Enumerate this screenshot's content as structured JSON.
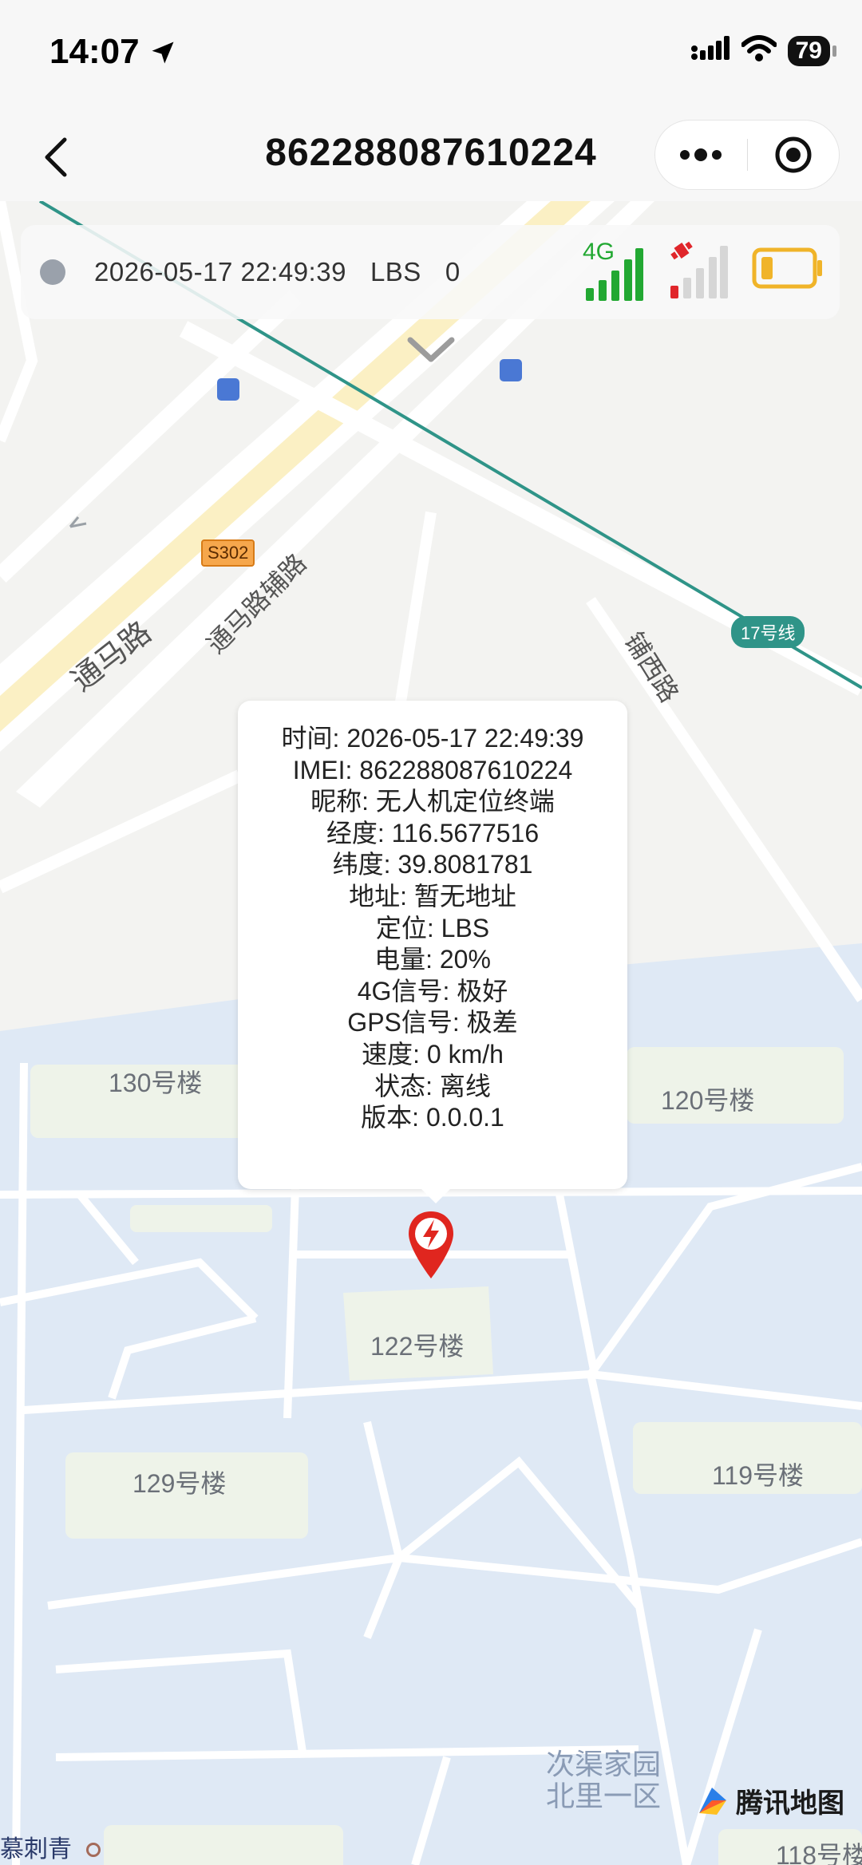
{
  "status_bar": {
    "time": "14:07",
    "battery": "79"
  },
  "nav": {
    "title": "862288087610224"
  },
  "info_bar": {
    "datetime": "2026-05-17 22:49:39",
    "mode": "LBS",
    "count": "0",
    "network_label": "4G"
  },
  "popup": {
    "lines": [
      {
        "label": "时间: ",
        "value": "2026-05-17 22:49:39"
      },
      {
        "label": "IMEI: ",
        "value": "862288087610224"
      },
      {
        "label": "昵称: ",
        "value": "无人机定位终端"
      },
      {
        "label": "经度: ",
        "value": "116.5677516"
      },
      {
        "label": "纬度: ",
        "value": "39.8081781"
      },
      {
        "label": "地址: ",
        "value": "暂无地址"
      },
      {
        "label": "定位: ",
        "value": "LBS"
      },
      {
        "label": "电量: ",
        "value": "20%"
      },
      {
        "label": "4G信号: ",
        "value": "极好"
      },
      {
        "label": "GPS信号: ",
        "value": "极差"
      },
      {
        "label": "速度: ",
        "value": "0 km/h"
      },
      {
        "label": "状态: ",
        "value": "离线"
      },
      {
        "label": "版本: ",
        "value": " 0.0.0.1"
      }
    ]
  },
  "map": {
    "roads": {
      "tongma": "通马路",
      "tongma_aux": "通马路辅路",
      "puxi": "铺西路",
      "s302": "S302",
      "metro": "17号线"
    },
    "buildings": {
      "b130": "130号楼",
      "b120": "120号楼",
      "b122": "122号楼",
      "b129": "129号楼",
      "b119": "119号楼",
      "b118": "118号楼"
    },
    "area_name_line1": "次渠家园",
    "area_name_line2": "北里一区",
    "poi_left": "慕刺青",
    "provider": "腾讯地图"
  },
  "colors": {
    "residential": "#dfe9f5",
    "building": "#eef3e9",
    "highway": "#fbf0c4",
    "metro": "#2f9488",
    "marker": "#e0261f",
    "battery_icon": "#f0b429",
    "signal_green": "#22a832",
    "signal_red": "#e0262b"
  }
}
